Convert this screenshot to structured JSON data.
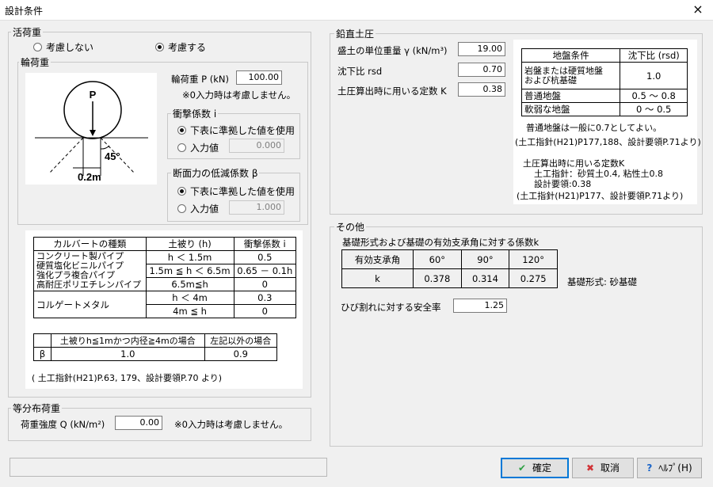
{
  "window": {
    "title": "設計条件",
    "close_icon": "×"
  },
  "live_load": {
    "legend": "活荷重",
    "opt_no": "考慮しない",
    "opt_yes": "考慮する",
    "selected": "考慮する"
  },
  "wheel_load": {
    "legend": "輪荷重",
    "diagram": {
      "p": "P",
      "angle": "45°",
      "width": "0.2m"
    },
    "p_label": "輪荷重 P (kN)",
    "p_value": "100.00",
    "note": "※0入力時は考慮しません。",
    "impact": {
      "legend": "衝撃係数 i",
      "opt_table": "下表に準拠した値を使用",
      "opt_input": "入力値",
      "input_value": "0.000"
    },
    "reduction": {
      "legend": "断面力の低減係数 β",
      "opt_table": "下表に準拠した値を使用",
      "opt_input": "入力値",
      "input_value": "1.000"
    },
    "impact_table": {
      "headers": [
        "カルバートの種類",
        "土被り (h)",
        "衝撃係数 i"
      ],
      "types": [
        "コンクリート製パイプ",
        "硬質塩化ビニルパイプ",
        "強化プラ複合パイプ",
        "高耐圧ポリエチレンパイプ",
        "コルゲートメタル"
      ],
      "rows": [
        [
          "h ＜ 1.5m",
          "0.5"
        ],
        [
          "1.5m ≦ h ＜ 6.5m",
          "0.65 － 0.1h"
        ],
        [
          "6.5m≦h",
          "0"
        ],
        [
          "h ＜ 4m",
          "0.3"
        ],
        [
          "4m ≦ h",
          "0"
        ]
      ]
    },
    "beta_table": {
      "header1": "土被りh≦1mかつ内径≧4mの場合",
      "header2": "左記以外の場合",
      "row_label": "β",
      "v1": "1.0",
      "v2": "0.9"
    },
    "source": "( 土工指針(H21)P.63, 179、設計要領P.70 より)"
  },
  "distributed": {
    "legend": "等分布荷重",
    "label": "荷重強度 Q (kN/m²)",
    "value": "0.00",
    "note": "※0入力時は考慮しません。"
  },
  "vertical": {
    "legend": "鉛直土圧",
    "unit_weight_label": "盛土の単位重量 γ (kN/m³)",
    "unit_weight": "19.00",
    "settlement_label": "沈下比 rsd",
    "settlement": "0.70",
    "k_label": "土圧算出時に用いる定数 K",
    "k_value": "0.38",
    "table": {
      "headers": [
        "地盤条件",
        "沈下比 (rsd)"
      ],
      "rows": [
        [
          "岩盤または硬質地盤\nおよび杭基礎",
          "1.0"
        ],
        [
          "普通地盤",
          "0.5 ～ 0.8"
        ],
        [
          "軟弱な地盤",
          "0 ～ 0.5"
        ]
      ]
    },
    "note1": "普通地盤は一般に0.7としてよい。",
    "source1": "(土工指針(H21)P177,188、設計要領P.71より)",
    "note2": "土圧算出時に用いる定数K",
    "note3": "土工指針：砂質土0.4, 粘性土0.8",
    "note4": "設計要領:0.38",
    "source2": "(土工指針(H21)P177、設計要領P.71より)"
  },
  "other": {
    "legend": "その他",
    "coef_title": "基礎形式および基礎の有効支承角に対する係数k",
    "table": {
      "row_header": "有効支承角",
      "angles": [
        "60°",
        "90°",
        "120°"
      ],
      "k_label": "k",
      "k_values": [
        "0.378",
        "0.314",
        "0.275"
      ]
    },
    "base_type": "基礎形式: 砂基礎",
    "crack_label": "ひび割れに対する安全率",
    "crack_value": "1.25"
  },
  "buttons": {
    "ok": "確定",
    "cancel": "取消",
    "help": "ﾍﾙﾌﾟ(H)",
    "ok_icon": "check-icon",
    "cancel_icon": "x-icon",
    "help_icon": "question-icon"
  },
  "colors": {
    "ok_icon": "#2ea043",
    "cancel_icon": "#d13438",
    "help_icon": "#1a64c8",
    "focus": "#0078d7"
  }
}
